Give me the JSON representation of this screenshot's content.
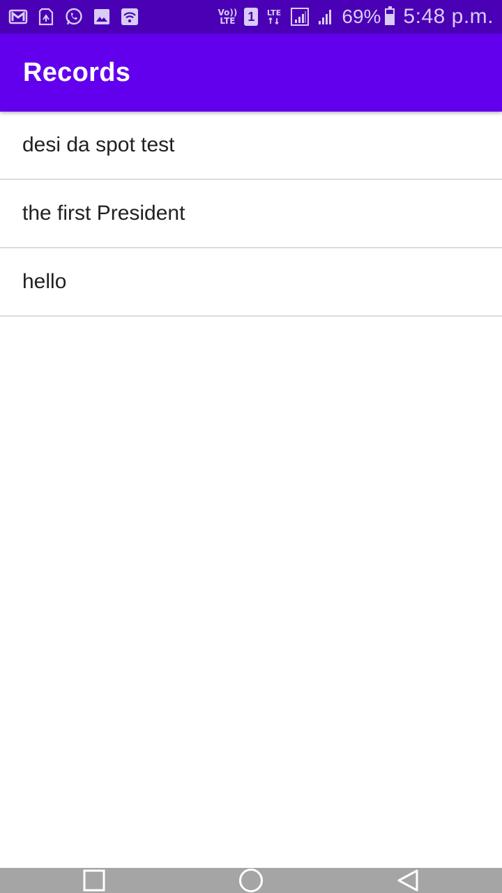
{
  "status_bar": {
    "left_icons": [
      "gmail-icon",
      "sim-update-icon",
      "whatsapp-icon",
      "gallery-icon",
      "wifi-icon"
    ],
    "volte_line1": "Vo))",
    "volte_line2": "LTE",
    "sim_slot": "1",
    "lte_label": "LTE",
    "battery_percent": "69%",
    "battery_level": 0.69,
    "time": "5:48 p.m.",
    "color": "#4a00b5",
    "icon_color": "#d9ccf5"
  },
  "app_bar": {
    "title": "Records",
    "color": "#6200ee"
  },
  "records": [
    {
      "label": "desi da spot test"
    },
    {
      "label": "the first President"
    },
    {
      "label": "hello"
    }
  ],
  "nav_bar": {
    "buttons": [
      "recent-apps-button",
      "home-button",
      "back-button"
    ],
    "color": "#a5a5a5"
  }
}
